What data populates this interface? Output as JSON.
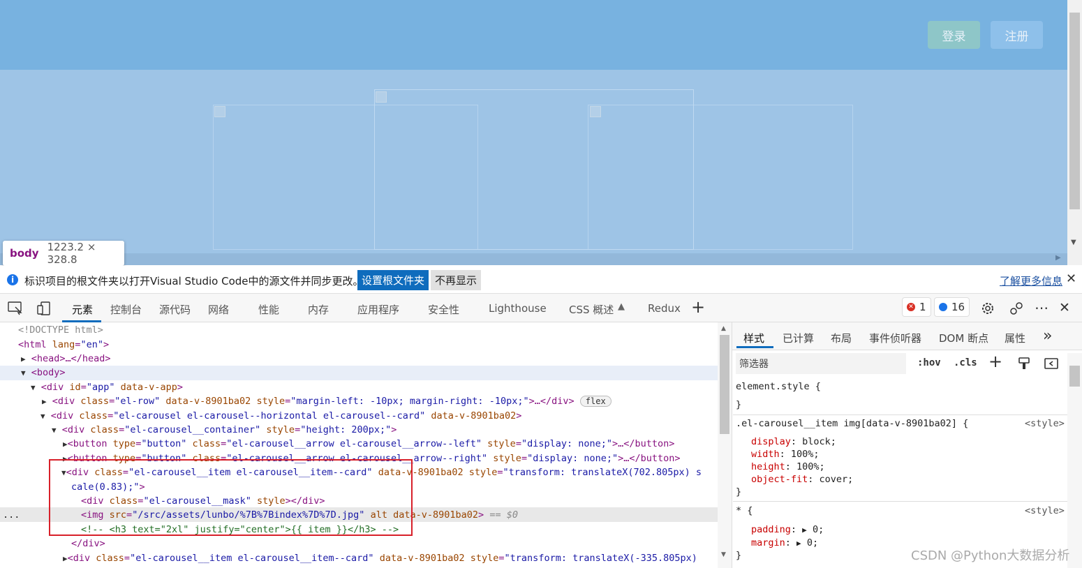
{
  "preview": {
    "login_label": "登录",
    "register_label": "注册",
    "tooltip_tag": "body",
    "tooltip_size": "1223.2 × 328.8"
  },
  "infobar": {
    "message": "标识项目的根文件夹以打开Visual Studio Code中的源文件并同步更改。",
    "set_root_label": "设置根文件夹",
    "dont_show_label": "不再显示",
    "learn_more_label": "了解更多信息",
    "close_glyph": "✕"
  },
  "tabs": [
    {
      "label": "元素"
    },
    {
      "label": "控制台"
    },
    {
      "label": "源代码"
    },
    {
      "label": "网络"
    },
    {
      "label": "性能"
    },
    {
      "label": "内存"
    },
    {
      "label": "应用程序"
    },
    {
      "label": "安全性"
    },
    {
      "label": "Lighthouse"
    },
    {
      "label": "CSS 概述"
    },
    {
      "label": "Redux"
    }
  ],
  "toolbar": {
    "add_tab_glyph": "+",
    "error_count": "1",
    "message_count": "16",
    "more_glyph": "⋯",
    "close_glyph": "✕"
  },
  "dom": {
    "doctype": "<!DOCTYPE html>",
    "html_tag": "<html",
    "html_attr": "lang",
    "html_val": "\"en\"",
    "html_close": ">",
    "head": "<head>…</head>",
    "body": "<body>",
    "app_tag": "<div",
    "app_attr1": "id",
    "app_val1": "\"app\"",
    "app_attr2": "data-v-app",
    "app_close": ">",
    "row_tag": "<div",
    "row_attr1": "class",
    "row_val1": "\"el-row\"",
    "row_attr2": "data-v-8901ba02",
    "row_attr3": "style",
    "row_val3": "\"margin-left: -10px; margin-right: -10px;\"",
    "row_close": ">…</div>",
    "row_badge": "flex",
    "carousel_tag": "<div",
    "carousel_attr1": "class",
    "carousel_val1": "\"el-carousel el-carousel--horizontal el-carousel--card\"",
    "carousel_attr2": "data-v-8901ba02",
    "carousel_close": ">",
    "container_tag": "<div",
    "container_attr1": "class",
    "container_val1": "\"el-carousel__container\"",
    "container_attr2": "style",
    "container_val2": "\"height: 200px;\"",
    "container_close": ">",
    "btnleft_tag": "<button",
    "btnleft_attr1": "type",
    "btnleft_val1": "\"button\"",
    "btnleft_attr2": "class",
    "btnleft_val2": "\"el-carousel__arrow el-carousel__arrow--left\"",
    "btnleft_attr3": "style",
    "btnleft_val3": "\"display: none;\"",
    "btnleft_close": ">…</button>",
    "btnright_tag": "<button",
    "btnright_attr1": "type",
    "btnright_val1": "\"button\"",
    "btnright_attr2": "class",
    "btnright_val2": "\"el-carousel__arrow el-carousel__arrow--right\"",
    "btnright_attr3": "style",
    "btnright_val3": "\"display: none;\"",
    "btnright_close": ">…</button>",
    "item_tag": "<div",
    "item_attr1": "class",
    "item_val1": "\"el-carousel__item el-carousel__item--card\"",
    "item_attr2": "data-v-8901ba02",
    "item_attr3": "style",
    "item_val3a": "\"transform: translateX(702.805px) s",
    "item_val3b": "cale(0.83);\"",
    "item_close": ">",
    "mask_tag": "<div",
    "mask_attr1": "class",
    "mask_val1": "\"el-carousel__mask\"",
    "mask_attr2": "style",
    "mask_close": "></div>",
    "ellipsis": "...",
    "img_tag": "<img",
    "img_attr1": "src",
    "img_val1": "\"/src/assets/lunbo/%7B%7Bindex%7D%7D.jpg\"",
    "img_attr2": "alt",
    "img_attr3": "data-v-8901ba02",
    "img_close": ">",
    "img_eq": "== $0",
    "comment": "<!-- <h3 text=\"2xl\" justify=\"center\">{{ item }}</h3> -->",
    "div_close": "</div>",
    "item2_tag": "<div",
    "item2_attr1": "class",
    "item2_val1": "\"el-carousel__item el-carousel__item--card\"",
    "item2_attr2": "data-v-8901ba02",
    "item2_attr3": "style",
    "item2_val3": "\"transform: translateX(-335.805px)"
  },
  "styles_tabs": [
    {
      "label": "样式"
    },
    {
      "label": "已计算"
    },
    {
      "label": "布局"
    },
    {
      "label": "事件侦听器"
    },
    {
      "label": "DOM 断点"
    },
    {
      "label": "属性"
    }
  ],
  "styles": {
    "more_glyph": "»",
    "filter_placeholder": "筛选器",
    "hov": ":hov",
    "cls": ".cls",
    "add_glyph": "+",
    "element_style": "element.style {",
    "brace_close": "}",
    "rule1_selector": ".el-carousel__item img[data-v-8901ba02] {",
    "rule1_source": "<style>",
    "rule1_p1": "display",
    "rule1_v1": "block;",
    "rule1_p2": "width",
    "rule1_v2": "100%;",
    "rule1_p3": "height",
    "rule1_v3": "100%;",
    "rule1_p4": "object-fit",
    "rule1_v4": "cover;",
    "rule2_selector": "* {",
    "rule2_source": "<style>",
    "rule2_p1": "padding",
    "rule2_v1": "0;",
    "rule2_p2": "margin",
    "rule2_v2": "0;"
  },
  "watermark": "CSDN @Python大数据分析"
}
